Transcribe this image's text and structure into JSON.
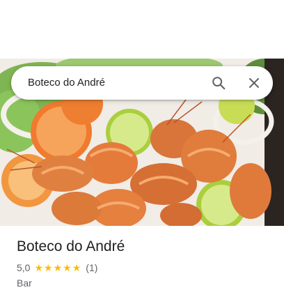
{
  "search": {
    "query": "Boteco do André"
  },
  "place": {
    "name": "Boteco do André",
    "rating": "5,0",
    "stars": 5,
    "review_count": "(1)",
    "category": "Bar"
  },
  "icons": {
    "search": "search-icon",
    "close": "close-icon",
    "star": "star-icon"
  },
  "colors": {
    "star": "#fbbc04",
    "text_primary": "#202124",
    "text_secondary": "#5f6368"
  }
}
